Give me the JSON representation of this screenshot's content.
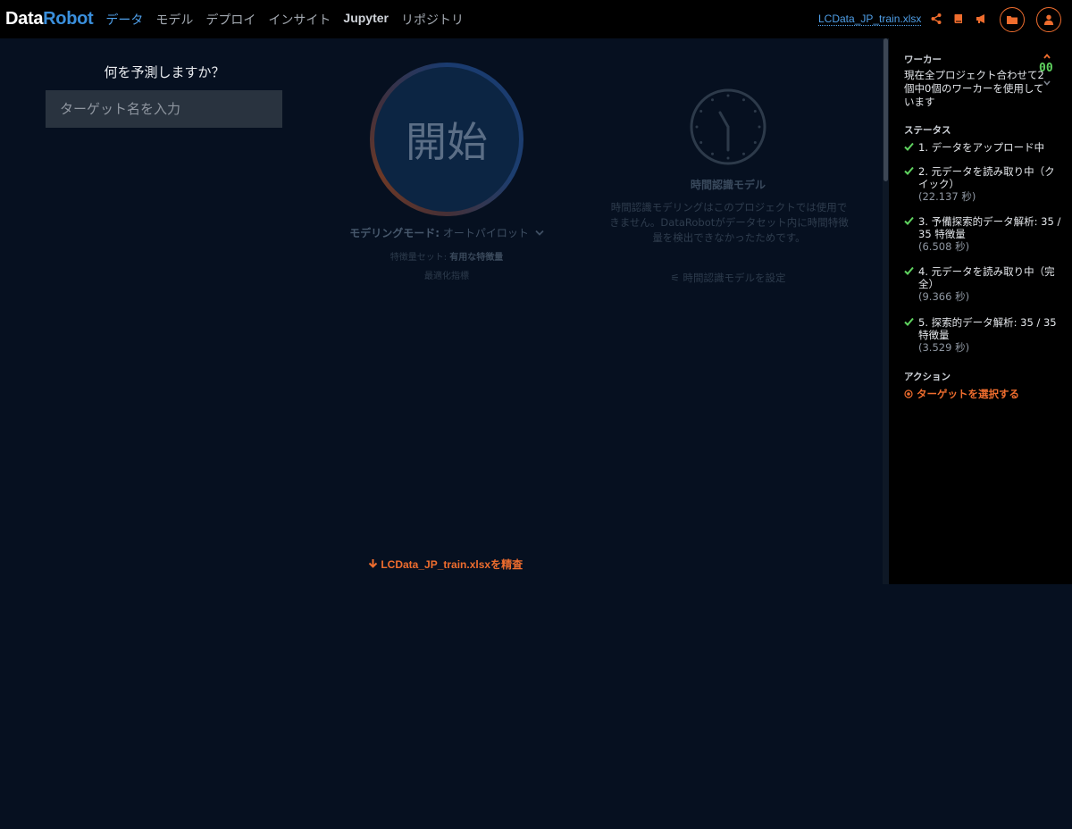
{
  "app": {
    "logo_part1": "Data",
    "logo_part2": "Robot"
  },
  "nav": {
    "items": [
      {
        "label": "データ",
        "active": true
      },
      {
        "label": "モデル",
        "active": false
      },
      {
        "label": "デプロイ",
        "active": false
      },
      {
        "label": "インサイト",
        "active": false
      },
      {
        "label": "Jupyter",
        "active": false
      },
      {
        "label": "リポジトリ",
        "active": false
      }
    ],
    "project_name": "LCData_JP_train.xlsx",
    "icons": [
      "share-icon",
      "book-icon",
      "megaphone-icon",
      "folder-icon",
      "user-icon"
    ]
  },
  "main": {
    "question": "何を予測しますか？",
    "target_placeholder": "ターゲット名を入力",
    "start_label": "開始",
    "mode_label": "モデリングモード:",
    "mode_value": "オートパイロット",
    "feature_set_label": "特徴量セット:",
    "feature_set_value": "有用な特徴量",
    "metric_label": "最適化指標",
    "time_aware": {
      "title": "時間認識モデル",
      "description": "時間認識モデリングはこのプロジェクトでは使用できません。DataRobotがデータセット内に時間特徴量を検出できなかったためです。",
      "setup_label": "時間認識モデルを設定"
    },
    "explore_link": "LCData_JP_train.xlsxを精査"
  },
  "side": {
    "worker_title": "ワーカー",
    "worker_text": "現在全プロジェクト合わせて2個中0個のワーカーを使用しています",
    "worker_count": "00",
    "status_title": "ステータス",
    "statuses": [
      {
        "text": "1. データをアップロード中",
        "time": ""
      },
      {
        "text": "2. 元データを読み取り中（クイック）",
        "time": "(22.137 秒)"
      },
      {
        "text": "3. 予備探索的データ解析: 35 / 35 特徴量",
        "time": "(6.508 秒)"
      },
      {
        "text": "4. 元データを読み取り中（完全）",
        "time": "(9.366 秒)"
      },
      {
        "text": "5. 探索的データ解析: 35 / 35 特徴量",
        "time": "(3.529 秒)"
      }
    ],
    "action_title": "アクション",
    "action_link": "ターゲットを選択する"
  },
  "colors": {
    "accent_orange": "#ef6d2e",
    "accent_blue": "#4f9fe8",
    "success_green": "#5fd35f",
    "background": "#061020"
  }
}
